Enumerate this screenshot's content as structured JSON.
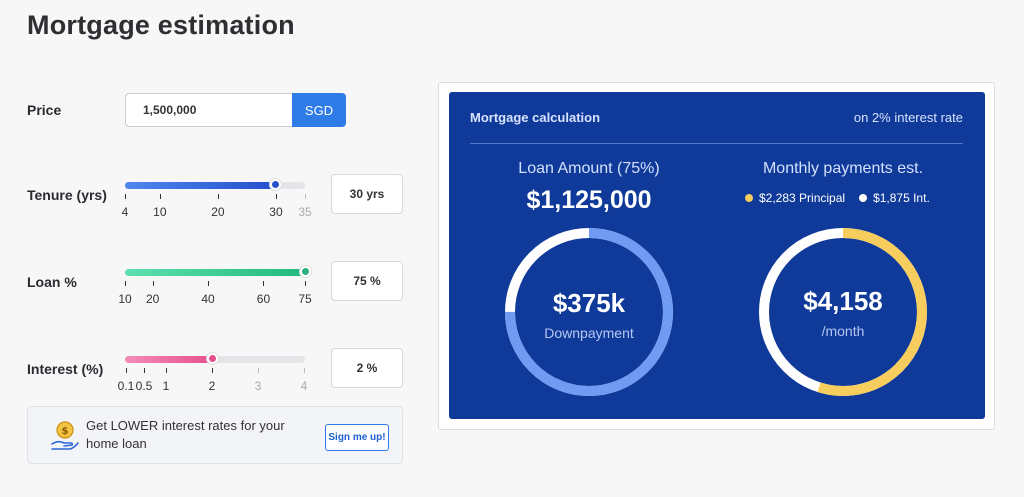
{
  "page": {
    "title": "Mortgage estimation"
  },
  "price": {
    "label": "Price",
    "value": "1,500,000",
    "currency": "SGD"
  },
  "tenure": {
    "label": "Tenure (yrs)",
    "value": 30,
    "min": 4,
    "max": 35,
    "display": "30 yrs",
    "ticks": [
      "4",
      "10",
      "20",
      "30",
      "35"
    ],
    "tick_values": [
      4,
      10,
      20,
      30,
      35
    ],
    "dim_ticks": [
      "35"
    ]
  },
  "loan": {
    "label": "Loan %",
    "value": 75,
    "min": 10,
    "max": 75,
    "display": "75 %",
    "ticks": [
      "10",
      "20",
      "40",
      "60",
      "75"
    ],
    "tick_values": [
      10,
      20,
      40,
      60,
      75
    ],
    "dim_ticks": []
  },
  "interest": {
    "label": "Interest (%)",
    "value": 2,
    "min": 0.1,
    "max": 4,
    "display": "2 %",
    "ticks": [
      "0.1",
      "0.5",
      "1",
      "2",
      "3",
      "4"
    ],
    "tick_values": [
      0.1,
      0.5,
      1,
      2,
      3,
      4
    ],
    "dim_ticks": [
      "3",
      "4"
    ]
  },
  "promo": {
    "text": "Get LOWER interest rates for your home loan",
    "button": "Sign me up!"
  },
  "card": {
    "title": "Mortgage calculation",
    "rate_note": "on 2% interest rate",
    "loan": {
      "label": "Loan Amount (75%)",
      "amount": "$1,125,000",
      "downpayment": "$375k",
      "downpayment_label": "Downpayment",
      "loan_fraction": 0.75
    },
    "monthly": {
      "label": "Monthly payments est.",
      "principal": "$2,283 Principal",
      "interest": "$1,875 Int.",
      "total": "$4,158",
      "unit": "/month",
      "principal_fraction": 0.549
    }
  },
  "colors": {
    "brand_blue": "#2f7be8",
    "card_bg": "#0f3a99",
    "tenure_fill": "#2f63dc",
    "loan_fill": "#3fd19a",
    "interest_fill": "#ee6ea4",
    "donut_loan": "#6f9bf2",
    "donut_principal": "#f7cd5e",
    "donut_interest": "#ffffff"
  }
}
